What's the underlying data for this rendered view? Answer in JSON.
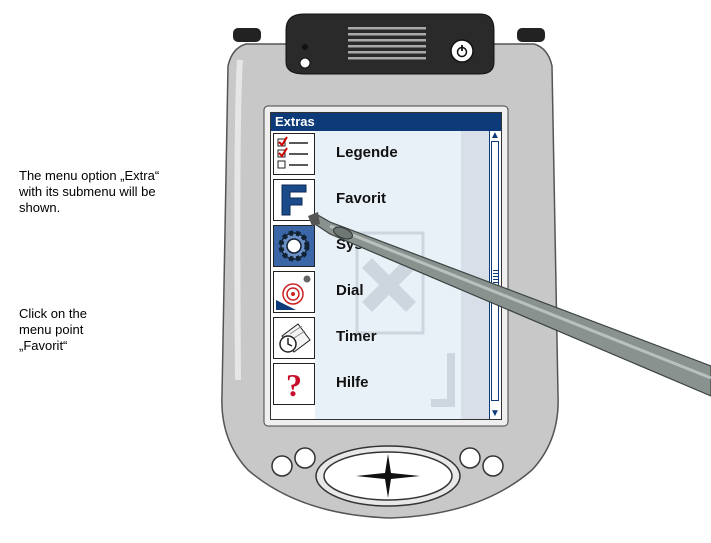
{
  "notes": {
    "note1": "The menu option „Extra“\nwith its submenu will be\nshown.",
    "note2": "Click on the\nmenu point\n„Favorit“"
  },
  "window": {
    "title": "Extras"
  },
  "menu": {
    "items": [
      {
        "label": "Legende",
        "icon": "checklist-icon"
      },
      {
        "label": "Favorit",
        "icon": "favorite-f-icon"
      },
      {
        "label": "Sys",
        "icon": "gear-icon"
      },
      {
        "label": "Dial",
        "icon": "dial-icon"
      },
      {
        "label": "Timer",
        "icon": "clock-icon"
      },
      {
        "label": "Hilfe",
        "icon": "help-icon"
      }
    ]
  },
  "scrollbar": {
    "up": "▲",
    "down": "▼"
  },
  "colors": {
    "titlebar": "#0d3a78",
    "device": "#c9c9c9",
    "stylus": "#8a9290"
  }
}
